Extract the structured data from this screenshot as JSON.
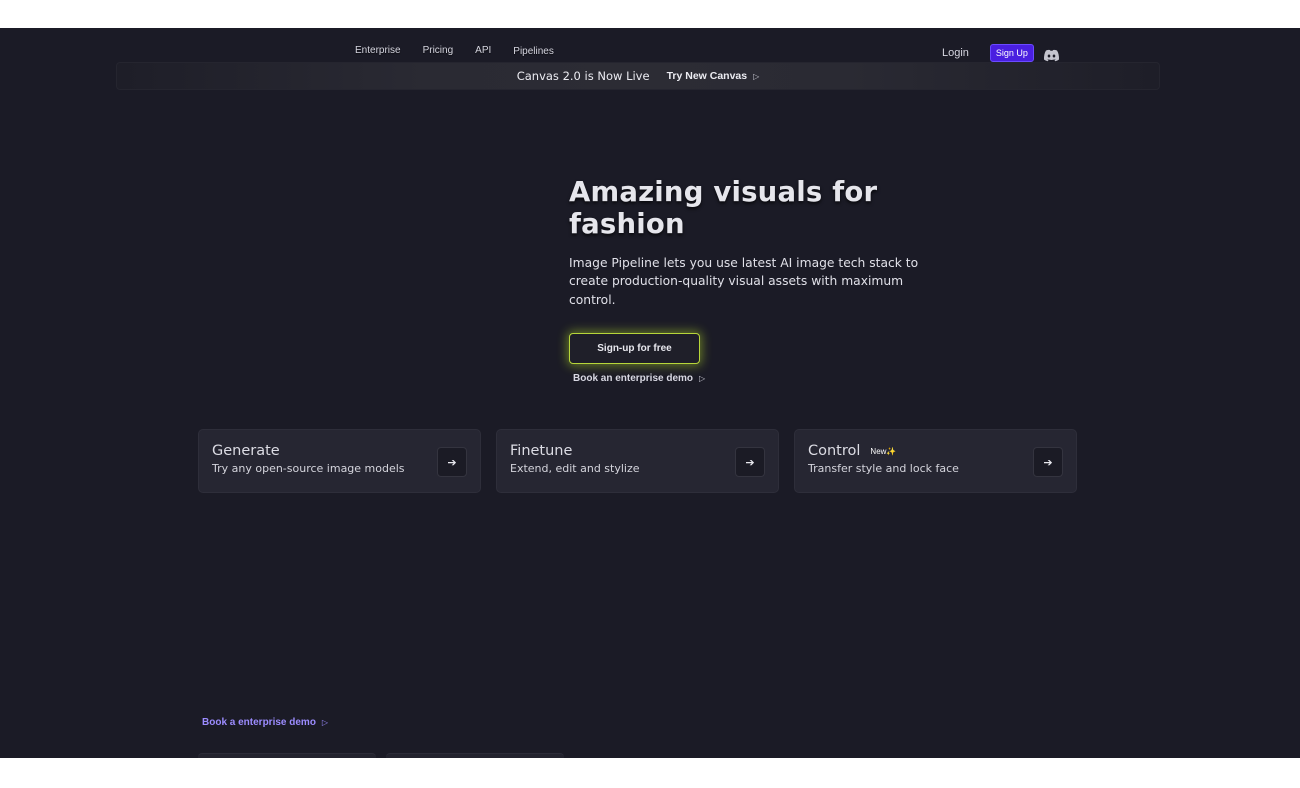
{
  "nav": {
    "links": [
      "Enterprise",
      "Pricing",
      "API",
      "Pipelines"
    ],
    "login": "Login",
    "signup": "Sign Up",
    "discord_icon": "discord-icon"
  },
  "announcement": {
    "text": "Canvas 2.0 is Now Live",
    "link": "Try New Canvas",
    "arrow": "▷"
  },
  "hero": {
    "title_line1": "Amazing visuals for",
    "title_line2": "fashion",
    "subtitle": "Image Pipeline lets you use latest AI image tech stack to create production-quality visual assets with maximum control.",
    "cta": "Sign-up for free",
    "demo_link": "Book an enterprise demo",
    "demo_arrow": "▷"
  },
  "cards": [
    {
      "title": "Generate",
      "desc": "Try any open-source image models",
      "badge": ""
    },
    {
      "title": "Finetune",
      "desc": "Extend, edit and stylize",
      "badge": ""
    },
    {
      "title": "Control",
      "desc": "Transfer style and lock face",
      "badge": "New✨"
    }
  ],
  "card_arrow": "➔",
  "bottom": {
    "demo_link": "Book a enterprise demo",
    "arrow": "▷"
  },
  "colors": {
    "background": "#1b1b26",
    "accent_signup": "#4a1fe0",
    "cta_glow": "#b7d63a",
    "link_purple": "#9c8cff"
  }
}
